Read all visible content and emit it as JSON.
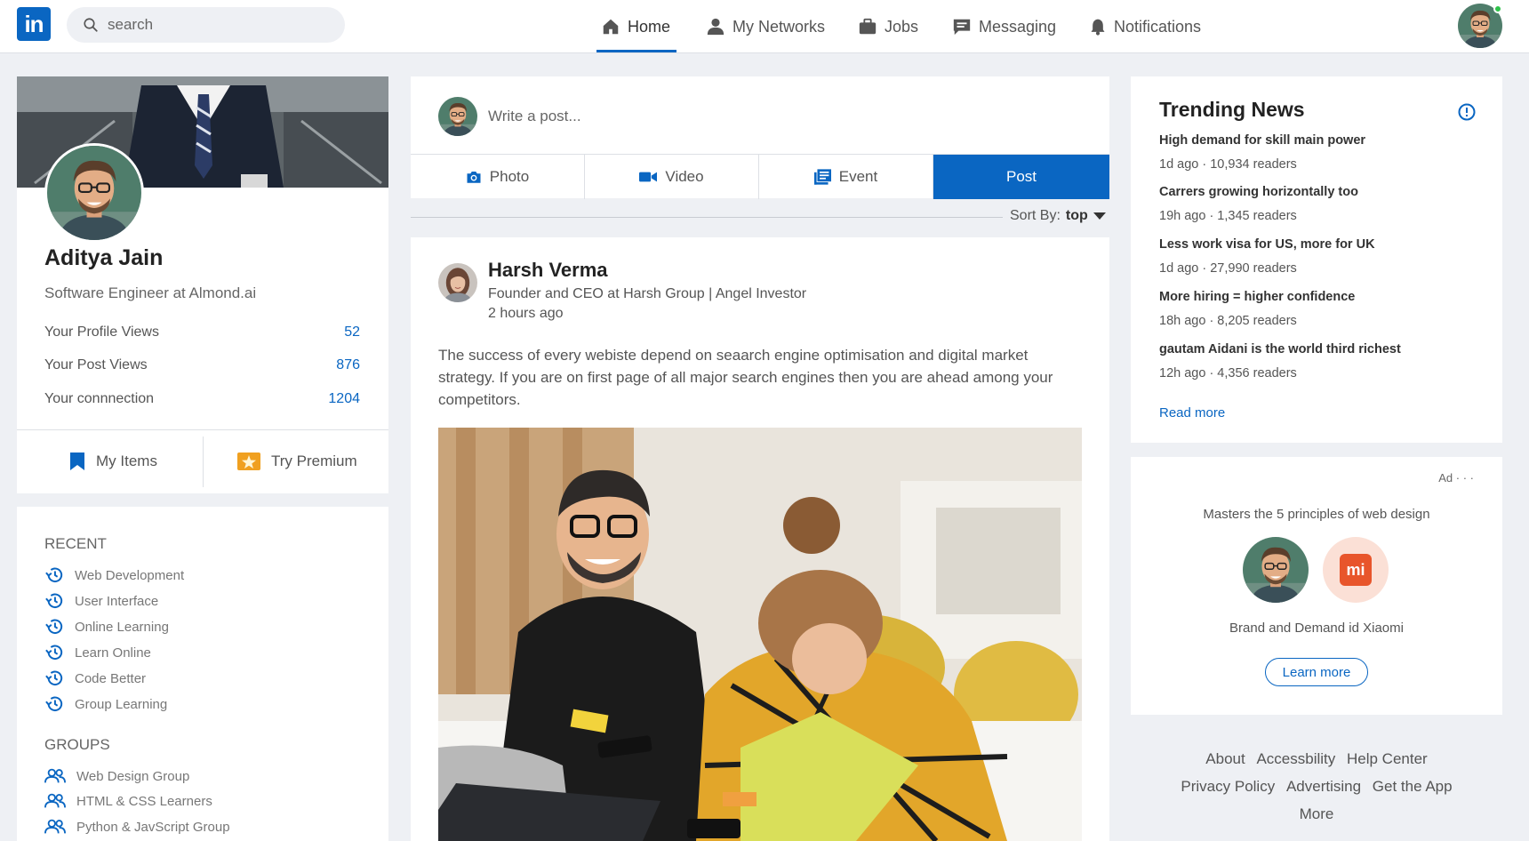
{
  "nav": {
    "logo_text": "in",
    "search_placeholder": "search",
    "items": [
      {
        "label": "Home",
        "icon": "home-icon"
      },
      {
        "label": "My Networks",
        "icon": "people-icon"
      },
      {
        "label": "Jobs",
        "icon": "briefcase-icon"
      },
      {
        "label": "Messaging",
        "icon": "chat-icon"
      },
      {
        "label": "Notifications",
        "icon": "bell-icon"
      }
    ],
    "active": "Home"
  },
  "profile": {
    "name": "Aditya Jain",
    "title": "Software Engineer at Almond.ai",
    "stats": [
      {
        "label": "Your Profile Views",
        "value": "52"
      },
      {
        "label": "Your Post Views",
        "value": "876"
      },
      {
        "label": "Your connnection",
        "value": "1204"
      }
    ],
    "my_items": "My Items",
    "try_premium": "Try Premium"
  },
  "recent": {
    "title": "RECENT",
    "items": [
      "Web Development",
      "User Interface",
      "Online Learning",
      "Learn Online",
      "Code Better",
      "Group Learning"
    ]
  },
  "groups": {
    "title": "GROUPS",
    "items": [
      "Web Design Group",
      "HTML & CSS Learners",
      "Python & JavScript Group"
    ]
  },
  "composer": {
    "placeholder": "Write a post...",
    "photo": "Photo",
    "video": "Video",
    "event": "Event",
    "post": "Post"
  },
  "sort": {
    "label": "Sort By:",
    "value": "top"
  },
  "post": {
    "author": "Harsh Verma",
    "headline": "Founder and CEO at Harsh Group | Angel Investor",
    "time": "2 hours ago",
    "text": "The success of every webiste depend on seaarch engine optimisation and digital market strategy. If you are on first page of all major search engines then you are ahead among your competitors."
  },
  "trending": {
    "title": "Trending News",
    "items": [
      {
        "headline": "High demand for skill main power",
        "meta": "1d ago · 10,934 readers"
      },
      {
        "headline": "Carrers growing horizontally too",
        "meta": "19h ago · 1,345 readers"
      },
      {
        "headline": "Less work visa for US, more for UK",
        "meta": "1d ago · 27,990 readers"
      },
      {
        "headline": "More hiring = higher confidence",
        "meta": "18h ago · 8,205 readers"
      },
      {
        "headline": "gautam Aidani is the world third richest",
        "meta": "12h ago · 4,356 readers"
      }
    ],
    "read_more": "Read more"
  },
  "ad": {
    "label": "Ad · · ·",
    "text": "Masters the 5 principles of web design",
    "logo_text": "mi",
    "brand": "Brand and Demand id Xiaomi",
    "cta": "Learn more"
  },
  "footer": {
    "links": [
      "About",
      "Accessbility",
      "Help Center",
      "Privacy Policy",
      "Advertising",
      "Get the App",
      "More"
    ]
  },
  "colors": {
    "accent": "#0a66c2",
    "background": "#eef0f4",
    "online": "#2ec24a",
    "premium": "#f0a020"
  }
}
